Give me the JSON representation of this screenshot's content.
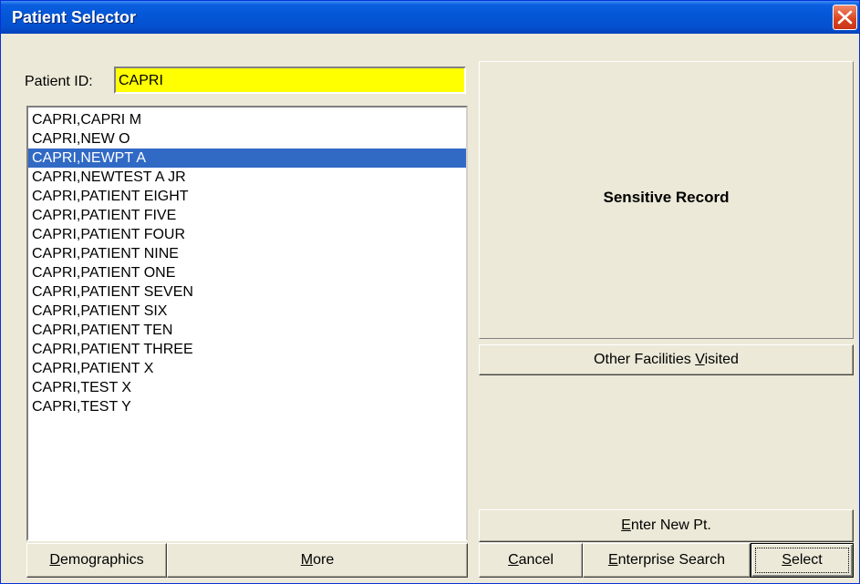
{
  "window": {
    "title": "Patient Selector"
  },
  "patient_id": {
    "label": "Patient ID:",
    "value": "CAPRI"
  },
  "patients": [
    "CAPRI,CAPRI M",
    "CAPRI,NEW O",
    "CAPRI,NEWPT A",
    "CAPRI,NEWTEST A JR",
    "CAPRI,PATIENT EIGHT",
    "CAPRI,PATIENT FIVE",
    "CAPRI,PATIENT FOUR",
    "CAPRI,PATIENT NINE",
    "CAPRI,PATIENT ONE",
    "CAPRI,PATIENT SEVEN",
    "CAPRI,PATIENT SIX",
    "CAPRI,PATIENT TEN",
    "CAPRI,PATIENT THREE",
    "CAPRI,PATIENT X",
    "CAPRI,TEST X",
    "CAPRI,TEST Y"
  ],
  "selected_patient": "CAPRI,NEWPT A",
  "panel": {
    "sensitive_text": "Sensitive Record"
  },
  "buttons": {
    "demographics": {
      "pre": "",
      "ul": "D",
      "post": "emographics"
    },
    "more": {
      "pre": "",
      "ul": "M",
      "post": "ore"
    },
    "other_facilities": {
      "pre": "Other Facilities ",
      "ul": "V",
      "post": "isited"
    },
    "enter_new": {
      "pre": "",
      "ul": "E",
      "post": "nter New Pt."
    },
    "cancel": {
      "pre": "",
      "ul": "C",
      "post": "ancel"
    },
    "enterprise_search": {
      "pre": "",
      "ul": "E",
      "post": "nterprise Search"
    },
    "select": {
      "pre": "",
      "ul": "S",
      "post": "elect"
    }
  },
  "colors": {
    "titlebar": "#0458d8",
    "selection": "#316ac5",
    "input_bg": "#ffff00",
    "face": "#ece9d8"
  },
  "icons": {
    "close": "close-icon"
  }
}
